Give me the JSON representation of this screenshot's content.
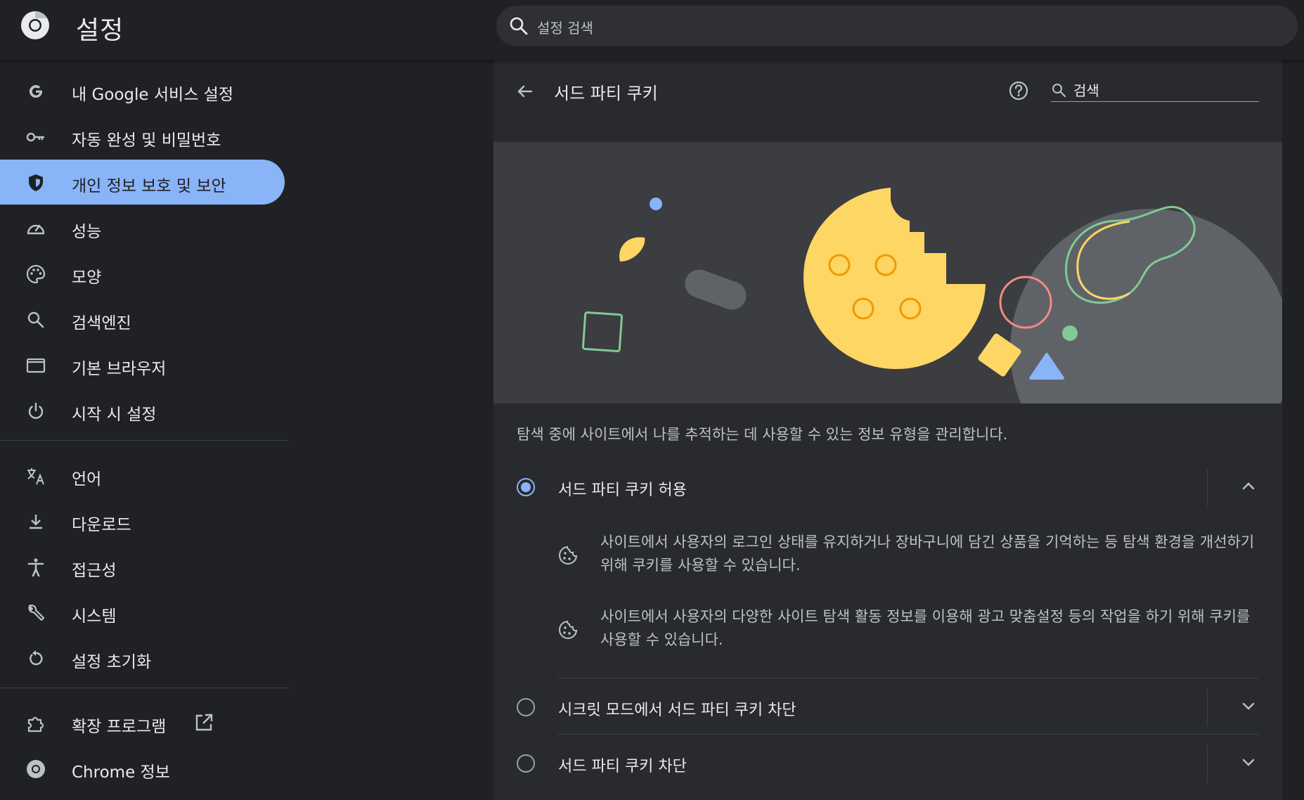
{
  "header": {
    "app_title": "설정",
    "search_placeholder": "설정 검색"
  },
  "sidebar": {
    "items": [
      {
        "label": "내 Google 서비스 설정",
        "icon": "google-icon"
      },
      {
        "label": "자동 완성 및 비밀번호",
        "icon": "key-icon"
      },
      {
        "label": "개인 정보 보호 및 보안",
        "icon": "shield-icon",
        "active": true
      },
      {
        "label": "성능",
        "icon": "speedometer-icon"
      },
      {
        "label": "모양",
        "icon": "palette-icon"
      },
      {
        "label": "검색엔진",
        "icon": "search-icon"
      },
      {
        "label": "기본 브라우저",
        "icon": "browser-window-icon"
      },
      {
        "label": "시작 시 설정",
        "icon": "power-icon"
      }
    ],
    "items2": [
      {
        "label": "언어",
        "icon": "translate-icon"
      },
      {
        "label": "다운로드",
        "icon": "download-icon"
      },
      {
        "label": "접근성",
        "icon": "accessibility-icon"
      },
      {
        "label": "시스템",
        "icon": "wrench-icon"
      },
      {
        "label": "설정 초기화",
        "icon": "reset-icon"
      }
    ],
    "items3": [
      {
        "label": "확장 프로그램",
        "icon": "extension-icon"
      },
      {
        "label": "Chrome 정보",
        "icon": "chrome-icon"
      }
    ]
  },
  "main": {
    "page_title": "서드 파티 쿠키",
    "search_label": "검색",
    "description": "탐색 중에 사이트에서 나를 추적하는 데 사용할 수 있는 정보 유형을 관리합니다.",
    "options": [
      {
        "label": "서드 파티 쿠키 허용",
        "selected": true,
        "expanded": true
      },
      {
        "label": "시크릿 모드에서 서드 파티 쿠키 차단",
        "selected": false,
        "expanded": false
      },
      {
        "label": "서드 파티 쿠키 차단",
        "selected": false,
        "expanded": false
      }
    ],
    "details": [
      {
        "text": "사이트에서 사용자의 로그인 상태를 유지하거나 장바구니에 담긴 상품을 기억하는 등 탐색 환경을 개선하기 위해 쿠키를 사용할 수 있습니다."
      },
      {
        "text": "사이트에서 사용자의 다양한 사이트 탐색 활동 정보를 이용해 광고 맞춤설정 등의 작업을 하기 위해 쿠키를 사용할 수 있습니다."
      }
    ]
  },
  "colors": {
    "background": "#202124",
    "panel": "#292a2d",
    "accent": "#8ab4f8",
    "cookie": "#fdd663"
  }
}
